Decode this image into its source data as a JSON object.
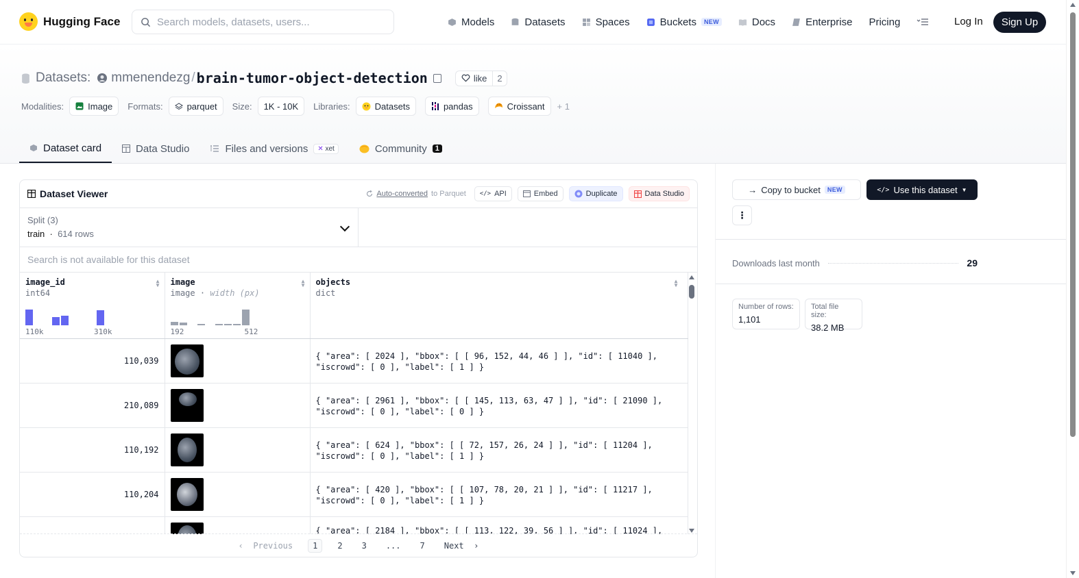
{
  "nav": {
    "brand": "Hugging Face",
    "search_placeholder": "Search models, datasets, users...",
    "items": [
      {
        "label": "Models",
        "icon": "models-icon"
      },
      {
        "label": "Datasets",
        "icon": "datasets-icon"
      },
      {
        "label": "Spaces",
        "icon": "spaces-icon"
      },
      {
        "label": "Buckets",
        "icon": "buckets-icon",
        "badge": "NEW"
      },
      {
        "label": "Docs",
        "icon": "docs-icon"
      },
      {
        "label": "Enterprise",
        "icon": "enterprise-icon"
      },
      {
        "label": "Pricing"
      }
    ],
    "login": "Log In",
    "signup": "Sign Up"
  },
  "repo": {
    "type_label": "Datasets:",
    "owner": "mmenendezg",
    "name": "brain-tumor-object-detection",
    "like_label": "like",
    "like_count": "2"
  },
  "tags": {
    "modalities_label": "Modalities:",
    "modality": "Image",
    "formats_label": "Formats:",
    "format": "parquet",
    "size_label": "Size:",
    "size": "1K - 10K",
    "libraries_label": "Libraries:",
    "libraries": [
      "Datasets",
      "pandas",
      "Croissant"
    ],
    "more": "+ 1"
  },
  "tabs": {
    "dataset_card": "Dataset card",
    "data_studio": "Data Studio",
    "files": "Files and versions",
    "xet": "xet",
    "community": "Community",
    "community_count": "1"
  },
  "viewer": {
    "title": "Dataset Viewer",
    "auto_converted": "Auto-converted",
    "to_parquet": "to Parquet",
    "api": "API",
    "embed": "Embed",
    "duplicate": "Duplicate",
    "data_studio": "Data Studio",
    "split_label": "Split (3)",
    "split_name": "train",
    "split_rows": "614 rows",
    "search_disabled": "Search is not available for this dataset",
    "columns": [
      {
        "name": "image_id",
        "type": "int64",
        "hist_min": "110k",
        "hist_max": "310k"
      },
      {
        "name": "image",
        "type": "image",
        "type_extra": "width (px)",
        "hist_min": "192",
        "hist_max": "512"
      },
      {
        "name": "objects",
        "type": "dict"
      }
    ],
    "hist_image_id": [
      0.9,
      0,
      0,
      0.45,
      0.55,
      0,
      0,
      0,
      0.85
    ],
    "hist_image": [
      0.2,
      0.15,
      0,
      0.04,
      0,
      0.03,
      0.03,
      0.03,
      0.9
    ],
    "rows": [
      {
        "image_id": "110,039",
        "objects": "{ \"area\": [ 2024 ], \"bbox\": [ [ 96, 152, 44, 46 ] ], \"id\": [ 11040 ],\n\"iscrowd\": [ 0 ], \"label\": [ 1 ] }"
      },
      {
        "image_id": "210,089",
        "objects": "{ \"area\": [ 2961 ], \"bbox\": [ [ 145, 113, 63, 47 ] ], \"id\": [ 21090 ],\n\"iscrowd\": [ 0 ], \"label\": [ 0 ] }"
      },
      {
        "image_id": "110,192",
        "objects": "{ \"area\": [ 624 ], \"bbox\": [ [ 72, 157, 26, 24 ] ], \"id\": [ 11204 ],\n\"iscrowd\": [ 0 ], \"label\": [ 1 ] }"
      },
      {
        "image_id": "110,204",
        "objects": "{ \"area\": [ 420 ], \"bbox\": [ [ 107, 78, 20, 21 ] ], \"id\": [ 11217 ],\n\"iscrowd\": [ 0 ], \"label\": [ 1 ] }"
      },
      {
        "image_id": "",
        "objects": "{ \"area\": [ 2184 ], \"bbox\": [ [ 113, 122, 39, 56 ] ], \"id\": [ 11024 ],"
      }
    ],
    "pager": {
      "previous": "Previous",
      "pages": [
        "1",
        "2",
        "3",
        "...",
        "7"
      ],
      "next": "Next"
    }
  },
  "sidebar": {
    "copy_bucket": "Copy to bucket",
    "copy_badge": "NEW",
    "use_dataset": "Use this dataset",
    "downloads_label": "Downloads last month",
    "downloads": "29",
    "rows_label": "Number of rows:",
    "rows": "1,101",
    "size_label": "Total file size:",
    "size": "38.2 MB"
  }
}
